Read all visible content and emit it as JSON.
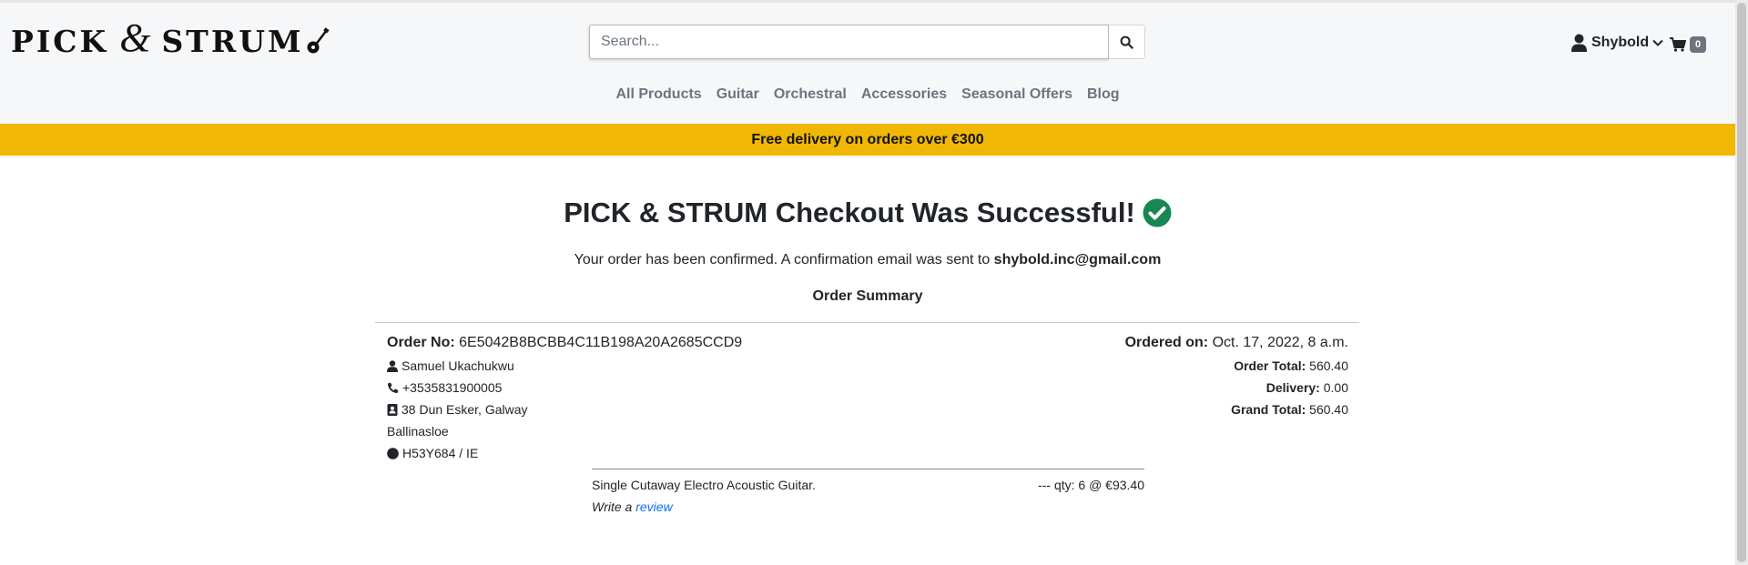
{
  "brand": {
    "logo_left": "PICK",
    "logo_amp": "&",
    "logo_right": "STRUM"
  },
  "search": {
    "placeholder": "Search..."
  },
  "account": {
    "username": "Shybold"
  },
  "cart": {
    "count": "0"
  },
  "nav": {
    "items": [
      "All Products",
      "Guitar",
      "Orchestral",
      "Accessories",
      "Seasonal Offers",
      "Blog"
    ]
  },
  "banner": {
    "text": "Free delivery on orders over €300"
  },
  "page": {
    "title": "PICK & STRUM Checkout Was Successful!",
    "confirm_text": "Your order has been confirmed. A confirmation email was sent to",
    "email": "shybold.inc@gmail.com",
    "summary_heading": "Order Summary"
  },
  "order": {
    "number_label": "Order No:",
    "number": "6E5042B8BCBB4C11B198A20A2685CCD9",
    "name": "Samuel Ukachukwu",
    "phone": "+3535831900005",
    "address1": "38 Dun Esker, Galway",
    "address2": "Ballinasloe",
    "postcode_country": "H53Y684 / IE",
    "ordered_on_label": "Ordered on:",
    "ordered_on": "Oct. 17, 2022, 8 a.m.",
    "order_total_label": "Order Total:",
    "order_total": "560.40",
    "delivery_label": "Delivery:",
    "delivery": "0.00",
    "grand_total_label": "Grand Total:",
    "grand_total": "560.40"
  },
  "items": [
    {
      "name": "Single Cutaway Electro Acoustic Guitar.",
      "qty_text": "--- qty: 6 @ €93.40"
    }
  ],
  "review": {
    "prefix": "Write a",
    "link": "review"
  },
  "colors": {
    "banner": "#f0b705",
    "check": "#198754",
    "link": "#0d6efd",
    "badge": "#6c757d"
  }
}
